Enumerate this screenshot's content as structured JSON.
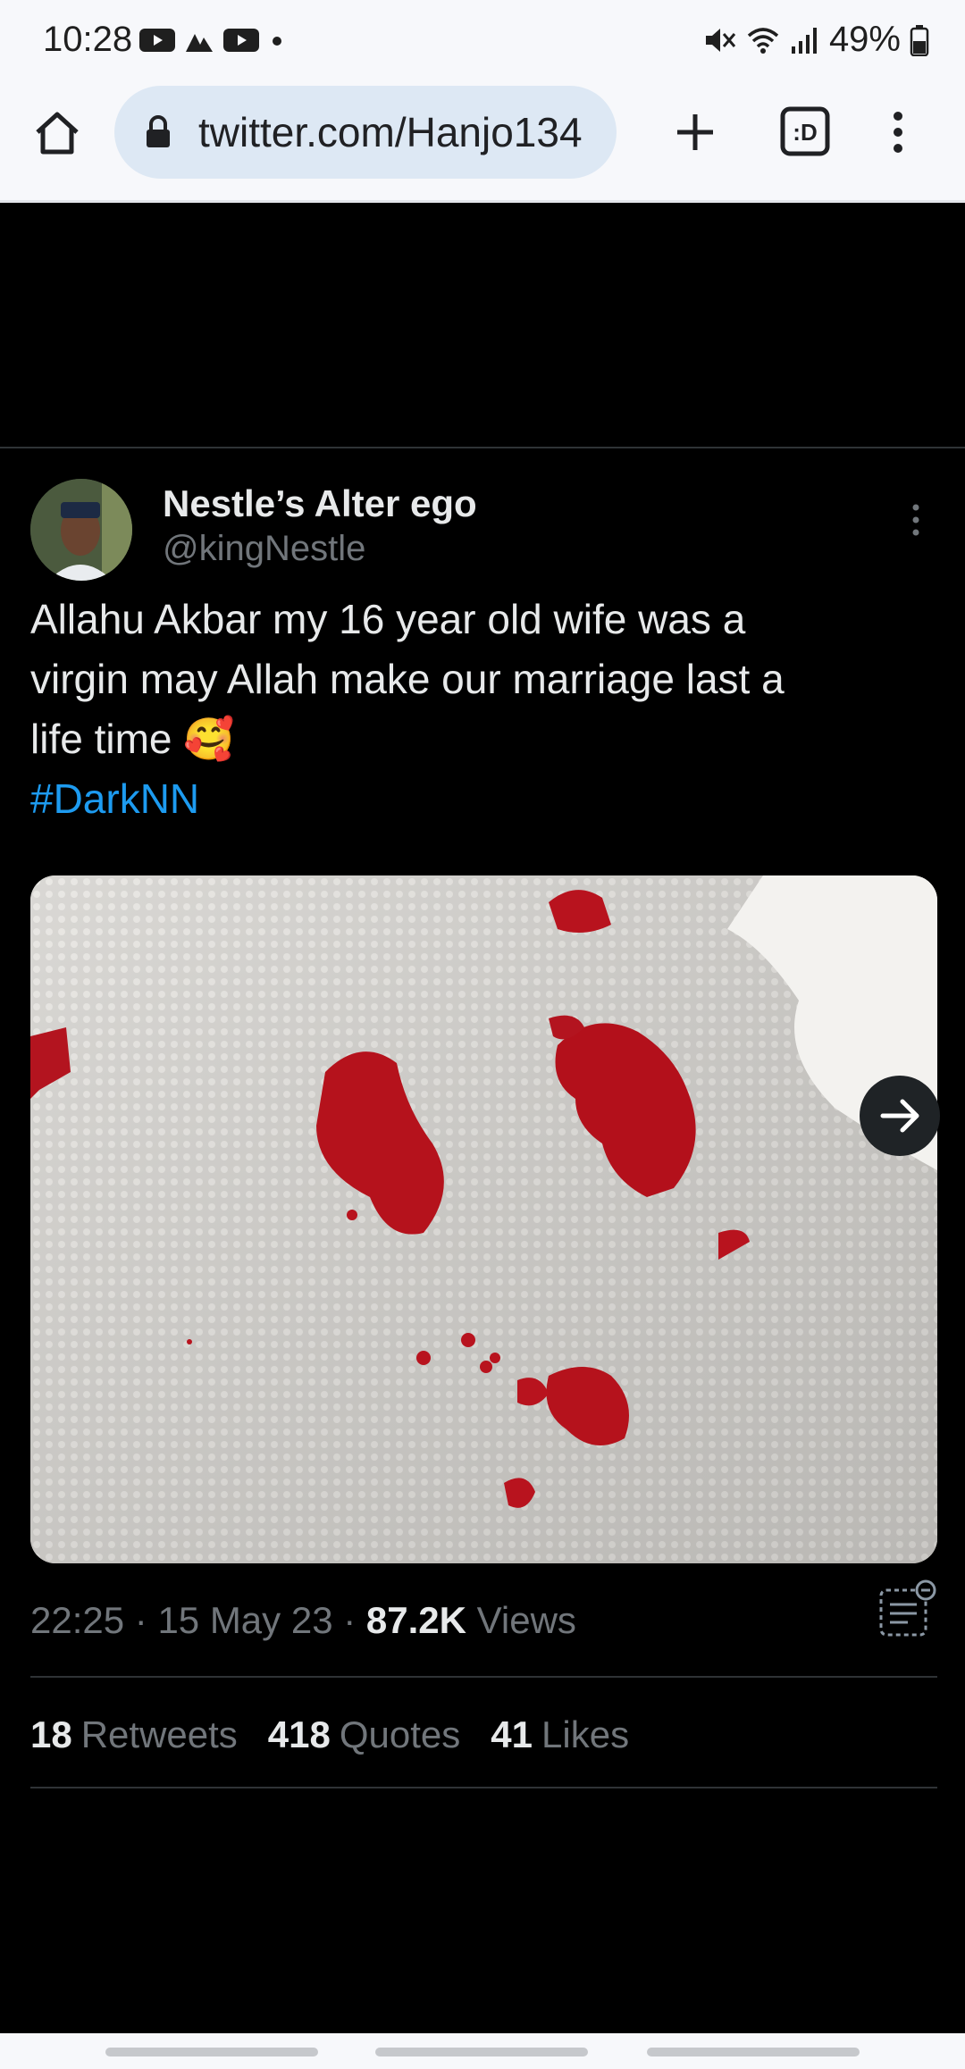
{
  "status_bar": {
    "time": "10:28",
    "battery": "49%",
    "icons": [
      "youtube-icon",
      "signal-arrows-icon",
      "youtube-icon",
      "dot-icon",
      "mute-icon",
      "wifi-icon",
      "cell-signal-icon",
      "battery-icon"
    ]
  },
  "browser": {
    "url": "twitter.com/Hanjo134",
    "tab_badge": ":D"
  },
  "tweet": {
    "author_name": "Nestle’s Alter ego",
    "author_handle": "@kingNestle",
    "text_line1": "Allahu Akbar my 16 year old wife was a",
    "text_line2": "virgin may Allah make our marriage last a",
    "text_line3": "life time 🥰",
    "hashtag": "#DarkNN",
    "time": "22:25",
    "date": "15 May 23",
    "views_count": "87.2K",
    "views_label": "Views",
    "retweets_count": "18",
    "retweets_label": "Retweets",
    "quotes_count": "418",
    "quotes_label": "Quotes",
    "likes_count": "41",
    "likes_label": "Likes"
  }
}
